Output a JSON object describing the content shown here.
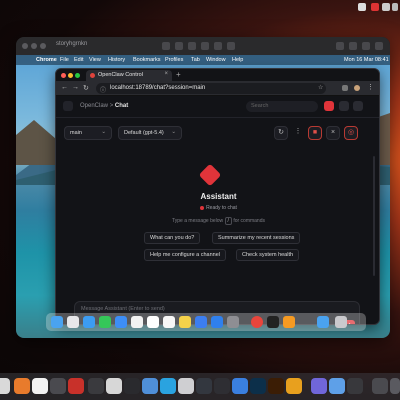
{
  "host": {
    "top_icons": [
      "window-icon",
      "menu-icon",
      "battery-icon",
      "wifi-icon"
    ]
  },
  "vm": {
    "title": "storyhgrnkn"
  },
  "menubar": {
    "apple": "",
    "items": [
      "Chrome",
      "File",
      "Edit",
      "View",
      "History",
      "Bookmarks",
      "Profiles",
      "Tab",
      "Window",
      "Help"
    ],
    "clock": "Mon 16 Mar 08:41"
  },
  "browser": {
    "tab_title": "OpenClaw Control",
    "url": "localhost:18789/chat?session=main",
    "new_tab": "+"
  },
  "app": {
    "crumb_root": "OpenClaw",
    "crumb_sep": ">",
    "crumb_current": "Chat",
    "search_placeholder": "Search",
    "session_select": "main",
    "model_select": "Default (gpt-5.4)",
    "assistant_title": "Assistant",
    "status": "Ready to chat",
    "hint_prefix": "Type a message below",
    "hint_key": "/",
    "hint_suffix": "for commands",
    "suggestions": [
      "What can you do?",
      "Summarize my recent sessions",
      "Help me configure a channel",
      "Check system health"
    ],
    "composer_placeholder": "Message Assistant (Enter to send)"
  },
  "colors": {
    "accent": "#e0343a",
    "app_bg": "#121317",
    "chrome_bg": "#1e1f24"
  }
}
